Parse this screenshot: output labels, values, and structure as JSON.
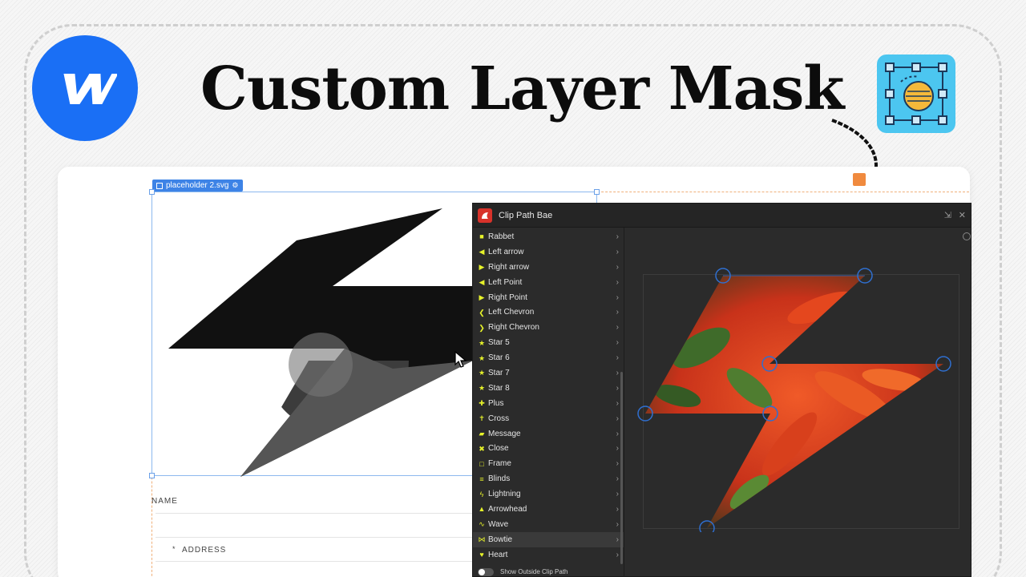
{
  "title": "Custom Layer Mask",
  "icons": {
    "brand": "webflow-logo",
    "app": "layer-mask-app-icon",
    "pointer": "arrow-pointer-icon"
  },
  "canvas": {
    "selection_label": "placeholder 2.svg",
    "form_labels": {
      "name": "NAME",
      "address": "ADDRESS"
    }
  },
  "panel": {
    "title": "Clip Path Bae",
    "shapes": [
      {
        "label": "Rabbet",
        "icon": "rabbet-icon"
      },
      {
        "label": "Left arrow",
        "icon": "left-arrow-icon"
      },
      {
        "label": "Right arrow",
        "icon": "right-arrow-icon"
      },
      {
        "label": "Left Point",
        "icon": "left-point-icon"
      },
      {
        "label": "Right Point",
        "icon": "right-point-icon"
      },
      {
        "label": "Left Chevron",
        "icon": "left-chevron-icon"
      },
      {
        "label": "Right Chevron",
        "icon": "right-chevron-icon"
      },
      {
        "label": "Star 5",
        "icon": "star-icon"
      },
      {
        "label": "Star 6",
        "icon": "star-icon"
      },
      {
        "label": "Star 7",
        "icon": "star-icon"
      },
      {
        "label": "Star 8",
        "icon": "star-icon"
      },
      {
        "label": "Plus",
        "icon": "plus-icon"
      },
      {
        "label": "Cross",
        "icon": "cross-icon"
      },
      {
        "label": "Message",
        "icon": "message-icon"
      },
      {
        "label": "Close",
        "icon": "close-icon"
      },
      {
        "label": "Frame",
        "icon": "frame-icon"
      },
      {
        "label": "Blinds",
        "icon": "blinds-icon"
      },
      {
        "label": "Lightning",
        "icon": "lightning-icon"
      },
      {
        "label": "Arrowhead",
        "icon": "arrowhead-icon"
      },
      {
        "label": "Wave",
        "icon": "wave-icon"
      },
      {
        "label": "Bowtie",
        "icon": "bowtie-icon",
        "selected": true
      },
      {
        "label": "Heart",
        "icon": "heart-icon"
      }
    ],
    "footer_toggle_label": "Show Outside Clip Path",
    "accent": "#e6f22a"
  },
  "colors": {
    "brand_blue": "#1a6ff5",
    "app_cyan": "#4cc6f0",
    "panel_bg": "#2b2b2b",
    "selection_blue": "#3d83e6",
    "handle_blue": "#2f6fd0"
  }
}
